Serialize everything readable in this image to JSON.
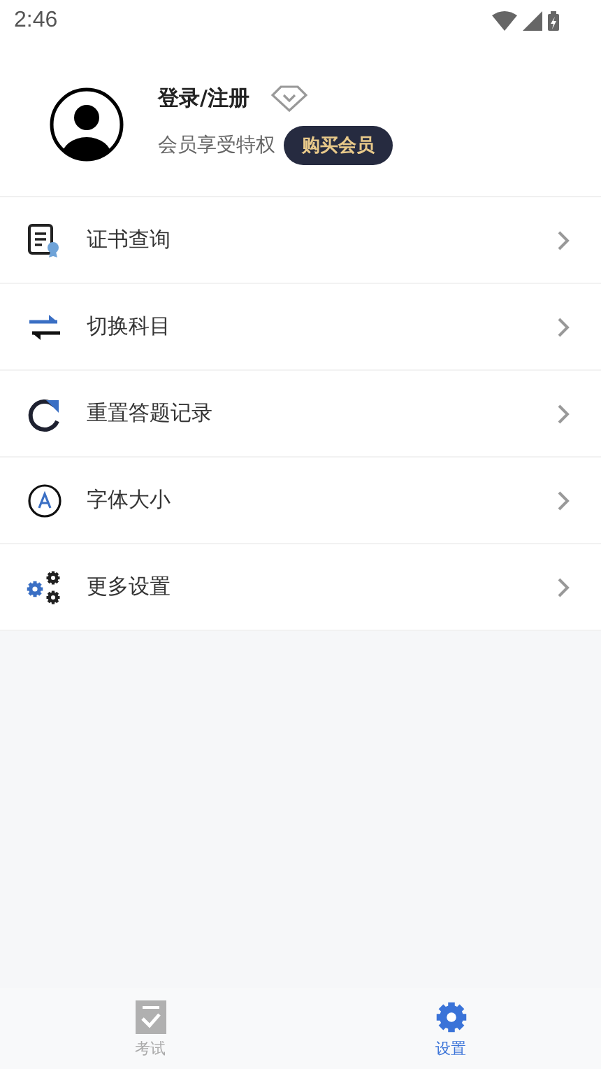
{
  "status_bar": {
    "time": "2:46"
  },
  "profile": {
    "name": "登录/注册",
    "subtitle": "会员享受特权",
    "vip_button": "购买会员"
  },
  "menu": [
    {
      "kind": "certificate",
      "label": "证书查询"
    },
    {
      "kind": "switch",
      "label": "切换科目"
    },
    {
      "kind": "reset",
      "label": "重置答题记录"
    },
    {
      "kind": "font",
      "label": "字体大小"
    },
    {
      "kind": "settings",
      "label": "更多设置"
    }
  ],
  "tabs": [
    {
      "kind": "exam",
      "label": "考试",
      "selected": false
    },
    {
      "kind": "settings",
      "label": "设置",
      "selected": true
    }
  ]
}
